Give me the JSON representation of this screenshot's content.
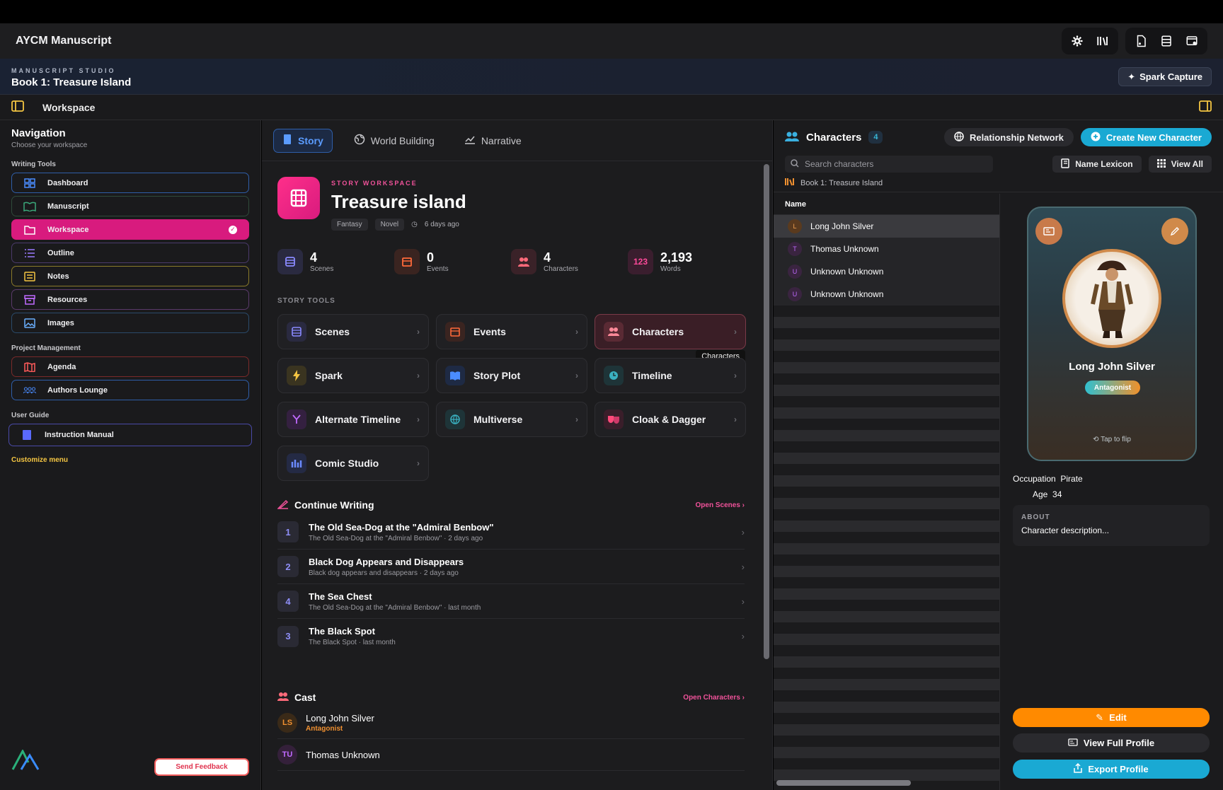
{
  "app": {
    "title": "AYCM Manuscript"
  },
  "studio": {
    "label": "MANUSCRIPT STUDIO",
    "title": "Book 1: Treasure Island",
    "spark_label": "Spark Capture"
  },
  "workspace": {
    "title": "Workspace"
  },
  "sidebar": {
    "title": "Navigation",
    "subtitle": "Choose your workspace",
    "writing_tools": "Writing Tools",
    "project_management": "Project Management",
    "user_guide": "User Guide",
    "items": [
      {
        "label": "Dashboard"
      },
      {
        "label": "Manuscript"
      },
      {
        "label": "Workspace"
      },
      {
        "label": "Outline"
      },
      {
        "label": "Notes"
      },
      {
        "label": "Resources"
      },
      {
        "label": "Images"
      }
    ],
    "pm_items": [
      {
        "label": "Agenda"
      },
      {
        "label": "Authors Lounge"
      }
    ],
    "guide_items": [
      {
        "label": "Instruction Manual"
      }
    ],
    "customize": "Customize menu",
    "feedback": "Send Feedback"
  },
  "tabs": [
    {
      "label": "Story"
    },
    {
      "label": "World Building"
    },
    {
      "label": "Narrative"
    }
  ],
  "story": {
    "label": "STORY WORKSPACE",
    "title": "Treasure island",
    "tags": [
      "Fantasy",
      "Novel"
    ],
    "updated": "6 days ago"
  },
  "stats": [
    {
      "value": "4",
      "label": "Scenes"
    },
    {
      "value": "0",
      "label": "Events"
    },
    {
      "value": "4",
      "label": "Characters"
    },
    {
      "value": "2,193",
      "label": "Words",
      "badge": "123"
    }
  ],
  "tools_label": "STORY TOOLS",
  "tools": [
    {
      "label": "Scenes"
    },
    {
      "label": "Events"
    },
    {
      "label": "Characters",
      "tooltip": "Characters"
    },
    {
      "label": "Spark"
    },
    {
      "label": "Story Plot"
    },
    {
      "label": "Timeline"
    },
    {
      "label": "Alternate Timeline"
    },
    {
      "label": "Multiverse"
    },
    {
      "label": "Cloak & Dagger"
    },
    {
      "label": "Comic Studio"
    }
  ],
  "continue": {
    "title": "Continue Writing",
    "link": "Open Scenes",
    "scenes": [
      {
        "num": "1",
        "title": "The Old Sea-Dog at the \"Admiral Benbow\"",
        "sub": "The Old Sea-Dog at the \"Admiral Benbow\"",
        "when": "2 days ago"
      },
      {
        "num": "2",
        "title": "Black Dog Appears and Disappears",
        "sub": "Black dog appears and disappears",
        "when": "2 days ago"
      },
      {
        "num": "4",
        "title": "The Sea Chest",
        "sub": "The Old Sea-Dog at the \"Admiral Benbow\"",
        "when": "last month"
      },
      {
        "num": "3",
        "title": "The Black Spot",
        "sub": "The Black Spot",
        "when": "last month"
      }
    ]
  },
  "cast": {
    "title": "Cast",
    "link": "Open Characters",
    "items": [
      {
        "initials": "LS",
        "name": "Long John Silver",
        "role": "Antagonist"
      },
      {
        "initials": "TU",
        "name": "Thomas Unknown",
        "role": ""
      }
    ]
  },
  "characters": {
    "title": "Characters",
    "count": "4",
    "network": "Relationship Network",
    "create": "Create New Character",
    "search_placeholder": "Search characters",
    "lexicon": "Name Lexicon",
    "view_all": "View All",
    "book": "Book 1: Treasure Island",
    "col_name": "Name",
    "rows": [
      {
        "initial": "L",
        "name": "Long John Silver"
      },
      {
        "initial": "T",
        "name": "Thomas Unknown"
      },
      {
        "initial": "U",
        "name": "Unknown Unknown"
      },
      {
        "initial": "U",
        "name": "Unknown Unknown"
      }
    ]
  },
  "detail": {
    "name": "Long John Silver",
    "role": "Antagonist",
    "flip": "Tap to flip",
    "occupation_label": "Occupation",
    "occupation": "Pirate",
    "age_label": "Age",
    "age": "34",
    "about_label": "ABOUT",
    "about": "Character description...",
    "edit": "Edit",
    "full": "View Full Profile",
    "export": "Export Profile"
  },
  "colors": {
    "accent": "#d81b7e",
    "cyan": "#1aa9d3",
    "orange": "#ff8a00"
  }
}
